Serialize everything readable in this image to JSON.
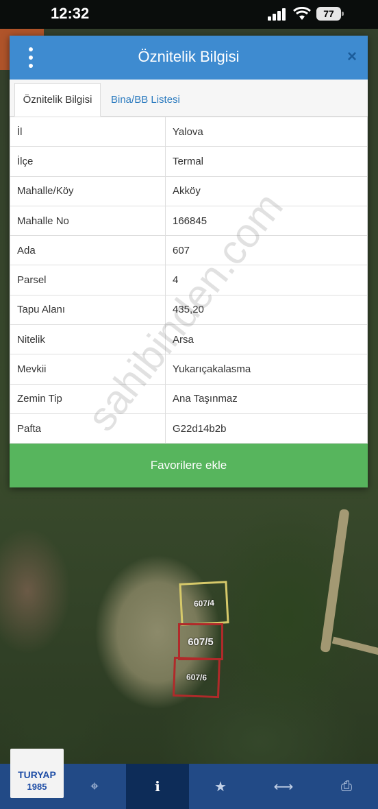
{
  "status_bar": {
    "time": "12:32",
    "battery": "77"
  },
  "dialog": {
    "title": "Öznitelik Bilgisi",
    "close_glyph": "×",
    "tabs": [
      {
        "label": "Öznitelik Bilgisi",
        "active": true
      },
      {
        "label": "Bina/BB Listesi",
        "active": false
      }
    ],
    "rows": [
      {
        "key": "İl",
        "value": "Yalova"
      },
      {
        "key": "İlçe",
        "value": "Termal"
      },
      {
        "key": "Mahalle/Köy",
        "value": "Akköy"
      },
      {
        "key": "Mahalle No",
        "value": "166845"
      },
      {
        "key": "Ada",
        "value": "607"
      },
      {
        "key": "Parsel",
        "value": "4"
      },
      {
        "key": "Tapu Alanı",
        "value": "435,20"
      },
      {
        "key": "Nitelik",
        "value": "Arsa"
      },
      {
        "key": "Mevkii",
        "value": "Yukarıçakalasma"
      },
      {
        "key": "Zemin Tip",
        "value": "Ana Taşınmaz"
      },
      {
        "key": "Pafta",
        "value": "G22d14b2b"
      }
    ],
    "favorite_button": "Favorilere ekle",
    "colors": {
      "header": "#3e8bd0",
      "button": "#57b55d",
      "tab_link": "#2c7bbf"
    }
  },
  "map": {
    "parcels": [
      {
        "label": "607/4",
        "color": "#d6c96a"
      },
      {
        "label": "607/5",
        "color": "#b02a2a"
      },
      {
        "label": "607/6",
        "color": "#b02a2a"
      }
    ]
  },
  "watermark": "sahibinden.com",
  "brand": {
    "name": "TURYAP",
    "year": "1985"
  },
  "toolbar": {
    "tools": [
      {
        "icon": "crosshair-icon",
        "glyph": "⌖"
      },
      {
        "icon": "info-icon",
        "glyph": "i",
        "active": true
      },
      {
        "icon": "star-icon",
        "glyph": "★"
      },
      {
        "icon": "measure-icon",
        "glyph": "⟷"
      },
      {
        "icon": "print-icon",
        "glyph": "⎙"
      }
    ],
    "colors": {
      "bar": "#224a86",
      "active": "#0d2c58"
    }
  }
}
